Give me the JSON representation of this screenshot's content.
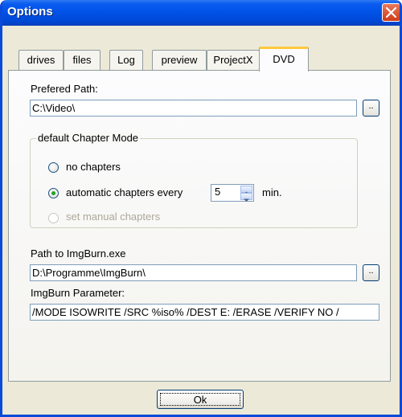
{
  "window": {
    "title": "Options"
  },
  "tabs": [
    {
      "label": "drives",
      "active": false
    },
    {
      "label": "files",
      "active": false
    },
    {
      "label": "Log",
      "active": false
    },
    {
      "label": "preview",
      "active": false
    },
    {
      "label": "ProjectX",
      "active": false
    },
    {
      "label": "DVD",
      "active": true
    }
  ],
  "dvd": {
    "preferred_path_label": "Prefered Path:",
    "preferred_path_value": "C:\\Video\\",
    "browse_label": "..",
    "chapter_group_title": "default Chapter Mode",
    "options": {
      "no_chapters": "no chapters",
      "automatic": "automatic chapters every",
      "manual": "set manual chapters"
    },
    "selected_option": "automatic",
    "interval_value": "5",
    "interval_unit": "min.",
    "imgburn_path_label": "Path to ImgBurn.exe",
    "imgburn_path_value": "D:\\Programme\\ImgBurn\\",
    "imgburn_param_label": "ImgBurn Parameter:",
    "imgburn_param_value": "/MODE ISOWRITE /SRC %iso% /DEST E: /ERASE /VERIFY NO /"
  },
  "footer": {
    "ok_label": "Ok"
  },
  "colors": {
    "title_bar": "#0052e6",
    "close_button": "#d74b2a",
    "active_tab_highlight": "#ffc83c",
    "dialog_bg": "#ece9d8"
  }
}
